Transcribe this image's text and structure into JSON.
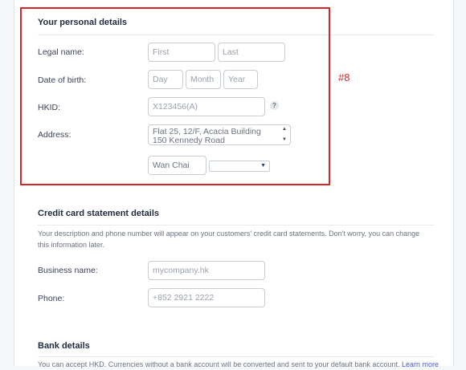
{
  "personal": {
    "title": "Your personal details",
    "legal_name_label": "Legal name:",
    "first_placeholder": "First",
    "last_placeholder": "Last",
    "dob_label": "Date of birth:",
    "day_placeholder": "Day",
    "month_placeholder": "Month",
    "year_placeholder": "Year",
    "hkid_label": "HKID:",
    "hkid_placeholder": "X123456(A)",
    "help_glyph": "?",
    "address_label": "Address:",
    "address_line1": "Flat 25, 12/F, Acacia Building",
    "address_line2": "150 Kennedy Road",
    "district_value": "Wan Chai",
    "region_select_value": ""
  },
  "annotation": {
    "marker": "#8",
    "color": "#e02424"
  },
  "statement": {
    "title": "Credit card statement details",
    "description": "Your description and phone number will appear on your customers' credit card statements. Don't worry, you can change this information later.",
    "business_label": "Business name:",
    "business_placeholder": "mycompany.hk",
    "phone_label": "Phone:",
    "phone_placeholder": "+852 2921 2222"
  },
  "bank": {
    "title": "Bank details",
    "description": "You can accept HKD. Currencies without a bank account will be converted and sent to your default bank account.",
    "link": "Learn more"
  },
  "icons": {
    "spin_up": "▲",
    "spin_down": "▼",
    "select_arrow": "▼"
  }
}
